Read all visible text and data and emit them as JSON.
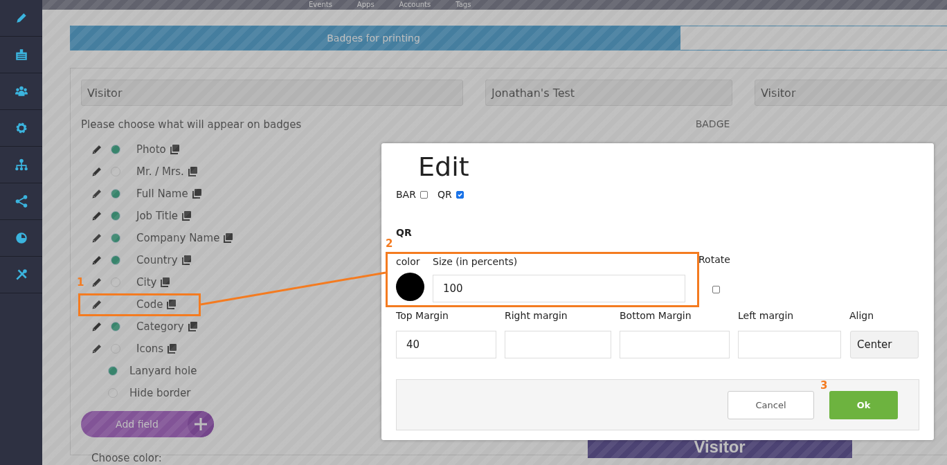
{
  "top_nav": {
    "items": [
      "Events",
      "Apps",
      "Accounts",
      "Tags"
    ]
  },
  "progress": {
    "label": "Badges for printing",
    "level": 0.69
  },
  "selectors": [
    "Visitor",
    "Jonathan's Test",
    "Visitor"
  ],
  "fields_prompt": "Please choose what will appear on badges",
  "fields": [
    {
      "label": "Photo",
      "kind": "field",
      "on": true
    },
    {
      "label": "Mr. / Mrs.",
      "kind": "field",
      "on": false
    },
    {
      "label": "Full Name",
      "kind": "field",
      "on": true
    },
    {
      "label": "Job Title",
      "kind": "field",
      "on": true
    },
    {
      "label": "Company Name",
      "kind": "field",
      "on": true
    },
    {
      "label": "Country",
      "kind": "field",
      "on": true
    },
    {
      "label": "City",
      "kind": "field",
      "on": false
    },
    {
      "label": "Code",
      "kind": "code"
    },
    {
      "label": "Category",
      "kind": "field",
      "on": true
    },
    {
      "label": "Icons",
      "kind": "field",
      "on": false
    },
    {
      "label": "Lanyard hole",
      "kind": "option",
      "on": true
    },
    {
      "label": "Hide border",
      "kind": "option",
      "on": false
    }
  ],
  "add_field_button": "Add field",
  "choose_color_label": "Choose color:",
  "badge_preview": {
    "title": "BADGE",
    "category": "Visitor"
  },
  "dialog": {
    "title": "Edit",
    "code_types": [
      {
        "label": "BAR",
        "checked": false
      },
      {
        "label": "QR",
        "checked": true
      }
    ],
    "section": "QR",
    "color_label": "color",
    "size_label": "Size (in percents)",
    "size_value": "100",
    "rotate_label": "Rotate",
    "rotate": false,
    "margins": [
      {
        "label": "Top Margin",
        "value": "40"
      },
      {
        "label": "Right margin"
      },
      {
        "label": "Bottom Margin"
      },
      {
        "label": "Left margin"
      }
    ],
    "align": {
      "label": "Align",
      "value": "Center"
    },
    "buttons": [
      {
        "label": "Cancel",
        "kind": "secondary"
      },
      {
        "label": "Ok",
        "kind": "primary"
      }
    ]
  },
  "annotations": [
    "1",
    "2",
    "3"
  ]
}
